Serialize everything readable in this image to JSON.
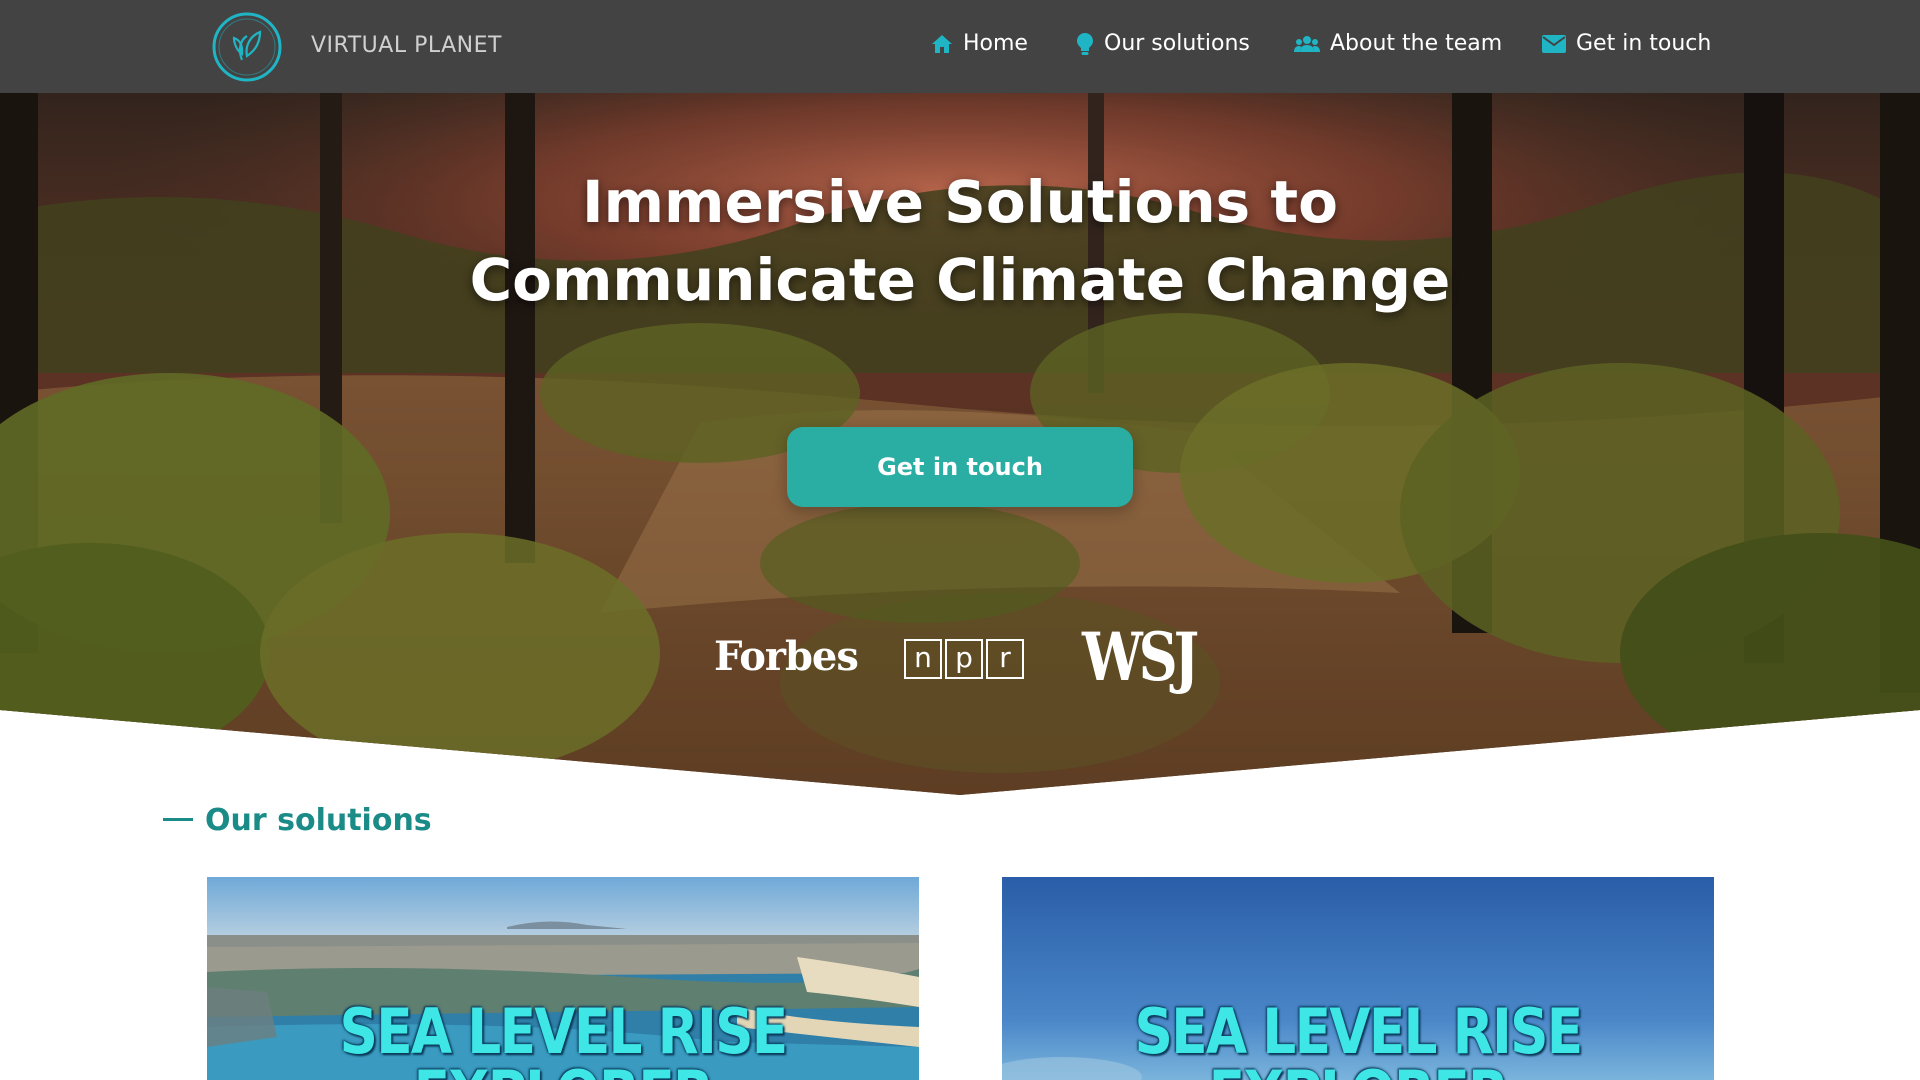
{
  "brand": {
    "name": "VIRTUAL PLANET"
  },
  "nav": {
    "items": [
      {
        "label": "Home",
        "icon": "home-icon"
      },
      {
        "label": "Our solutions",
        "icon": "lightbulb-icon"
      },
      {
        "label": "About the team",
        "icon": "team-icon"
      },
      {
        "label": "Get in touch",
        "icon": "mail-icon"
      }
    ]
  },
  "hero": {
    "title_line1": "Immersive Solutions to",
    "title_line2": "Communicate Climate Change",
    "cta_label": "Get in touch",
    "press": {
      "forbes": "Forbes",
      "npr": [
        "n",
        "p",
        "r"
      ],
      "wsj": "WSJ"
    }
  },
  "solutions": {
    "heading": "Our solutions",
    "cards": [
      {
        "title_line1": "SEA LEVEL RISE",
        "title_line2": "EXPLORER"
      },
      {
        "title_line1": "SEA LEVEL RISE",
        "title_line2": "EXPLORER"
      }
    ]
  },
  "colors": {
    "nav_bg": "#434343",
    "accent": "#2aaea3",
    "section_title": "#1a8b87",
    "logo_teal": "#1fb5c4",
    "card_text": "#3ee6e6"
  }
}
